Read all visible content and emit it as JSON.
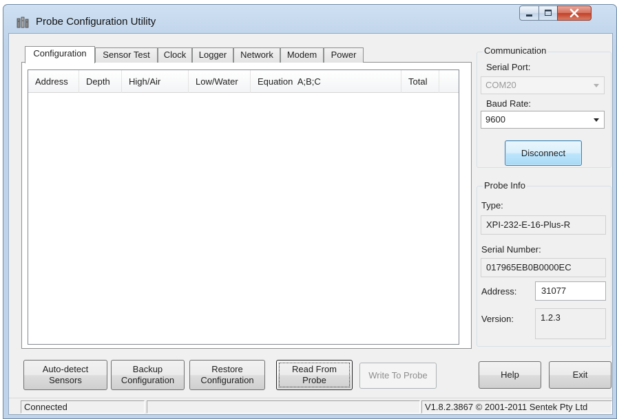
{
  "window": {
    "title": "Probe Configuration Utility",
    "icon": "probe-app-icon",
    "controls": [
      "minimize",
      "maximize",
      "close"
    ]
  },
  "tabs": [
    {
      "label": "Configuration",
      "active": true
    },
    {
      "label": "Sensor Test",
      "active": false
    },
    {
      "label": "Clock",
      "active": false
    },
    {
      "label": "Logger",
      "active": false
    },
    {
      "label": "Network",
      "active": false
    },
    {
      "label": "Modem",
      "active": false
    },
    {
      "label": "Power",
      "active": false
    }
  ],
  "sensor_table": {
    "columns": [
      "Address",
      "Depth",
      "High/Air",
      "Low/Water",
      "Equation  A;B;C",
      "Total"
    ],
    "rows": []
  },
  "communication": {
    "group_label": "Communication",
    "serial_port_label": "Serial Port:",
    "serial_port_value": "COM20",
    "baud_rate_label": "Baud Rate:",
    "baud_rate_value": "9600",
    "disconnect_label": "Disconnect"
  },
  "probe_info": {
    "group_label": "Probe Info",
    "type_label": "Type:",
    "type_value": "XPI-232-E-16-Plus-R",
    "serial_number_label": "Serial Number:",
    "serial_number_value": "017965EB0B0000EC",
    "address_label": "Address:",
    "address_value": "31077",
    "version_label": "Version:",
    "version_value": "1.2.3"
  },
  "buttons": {
    "auto_detect": [
      "Auto-detect",
      "Sensors"
    ],
    "backup": [
      "Backup",
      "Configuration"
    ],
    "restore": [
      "Restore",
      "Configuration"
    ],
    "read_from_probe": [
      "Read From",
      "Probe"
    ],
    "write_to_probe": "Write To Probe",
    "help": "Help",
    "exit": "Exit"
  },
  "status_bar": {
    "status": "Connected",
    "middle": "",
    "version_copyright": "V1.8.2.3867 © 2001-2011 Sentek Pty Ltd"
  }
}
